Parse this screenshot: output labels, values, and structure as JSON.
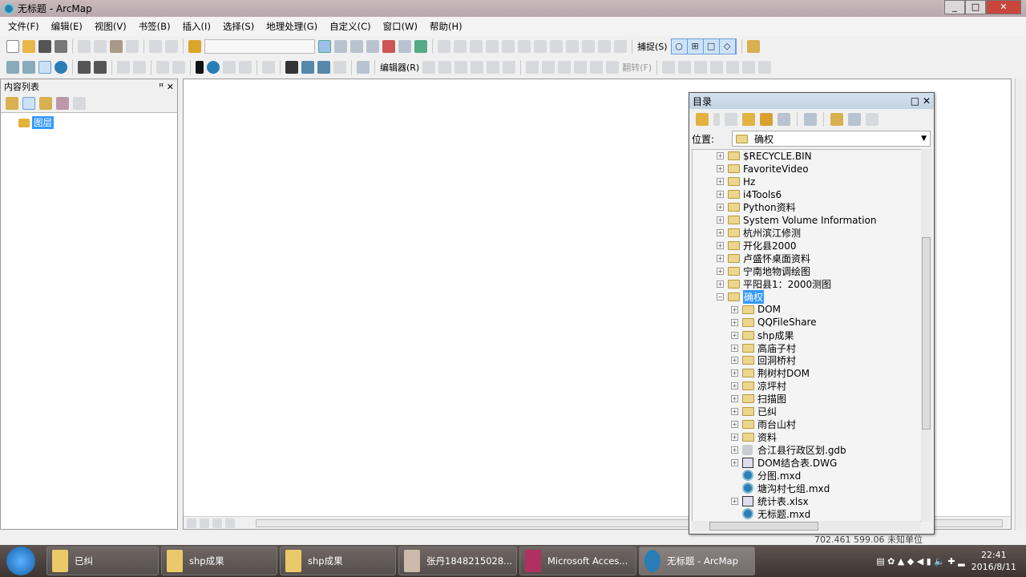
{
  "window": {
    "title": "无标题 - ArcMap"
  },
  "menu": [
    "文件(F)",
    "编辑(E)",
    "视图(V)",
    "书签(B)",
    "插入(I)",
    "选择(S)",
    "地理处理(G)",
    "自定义(C)",
    "窗口(W)",
    "帮助(H)"
  ],
  "toolbar": {
    "snap_label": "捕捉(S)",
    "editor_label": "编辑器(R)",
    "rotate_label": "翻转(F)"
  },
  "toc": {
    "title": "内容列表",
    "layers_label": "图层"
  },
  "catalog": {
    "title": "目录",
    "location_label": "位置:",
    "location_value": "确权",
    "tree": [
      {
        "label": "$RECYCLE.BIN",
        "type": "folder",
        "level": 0,
        "expander": "+"
      },
      {
        "label": "FavoriteVideo",
        "type": "folder",
        "level": 0,
        "expander": "+"
      },
      {
        "label": "Hz",
        "type": "folder",
        "level": 0,
        "expander": "+"
      },
      {
        "label": "i4Tools6",
        "type": "folder",
        "level": 0,
        "expander": "+"
      },
      {
        "label": "Python资料",
        "type": "folder",
        "level": 0,
        "expander": "+"
      },
      {
        "label": "System Volume Information",
        "type": "folder",
        "level": 0,
        "expander": "+"
      },
      {
        "label": "杭州滨江修测",
        "type": "folder",
        "level": 0,
        "expander": "+"
      },
      {
        "label": "开化县2000",
        "type": "folder",
        "level": 0,
        "expander": "+"
      },
      {
        "label": "卢盛怀桌面资料",
        "type": "folder",
        "level": 0,
        "expander": "+"
      },
      {
        "label": "宁南地物调绘图",
        "type": "folder",
        "level": 0,
        "expander": "+"
      },
      {
        "label": "平阳县1：2000测图",
        "type": "folder",
        "level": 0,
        "expander": "+"
      },
      {
        "label": "确权",
        "type": "folder",
        "level": 0,
        "expander": "-",
        "selected": true
      },
      {
        "label": "DOM",
        "type": "folder",
        "level": 1,
        "expander": "+"
      },
      {
        "label": "QQFileShare",
        "type": "folder",
        "level": 1,
        "expander": "+"
      },
      {
        "label": "shp成果",
        "type": "folder",
        "level": 1,
        "expander": "+"
      },
      {
        "label": "高庙子村",
        "type": "folder",
        "level": 1,
        "expander": "+"
      },
      {
        "label": "回洞桥村",
        "type": "folder",
        "level": 1,
        "expander": "+"
      },
      {
        "label": "荆树村DOM",
        "type": "folder",
        "level": 1,
        "expander": "+"
      },
      {
        "label": "凉坪村",
        "type": "folder",
        "level": 1,
        "expander": "+"
      },
      {
        "label": "扫描图",
        "type": "folder",
        "level": 1,
        "expander": "+"
      },
      {
        "label": "已纠",
        "type": "folder",
        "level": 1,
        "expander": "+"
      },
      {
        "label": "雨台山村",
        "type": "folder",
        "level": 1,
        "expander": "+"
      },
      {
        "label": "资料",
        "type": "folder",
        "level": 1,
        "expander": "+"
      },
      {
        "label": "合江县行政区划.gdb",
        "type": "gdb",
        "level": 1,
        "expander": "+"
      },
      {
        "label": "DOM结合表.DWG",
        "type": "sheet",
        "level": 1,
        "expander": "+"
      },
      {
        "label": "分图.mxd",
        "type": "mxd",
        "level": 1,
        "expander": ""
      },
      {
        "label": "塘沟村七组.mxd",
        "type": "mxd",
        "level": 1,
        "expander": ""
      },
      {
        "label": "统计表.xlsx",
        "type": "sheet",
        "level": 1,
        "expander": "+"
      },
      {
        "label": "无标题.mxd",
        "type": "mxd",
        "level": 1,
        "expander": ""
      }
    ]
  },
  "status": {
    "coords": "702.461  599.06 未知单位"
  },
  "taskbar": {
    "items": [
      "已纠",
      "shp成果",
      "shp成果",
      "张丹1848215028...",
      "Microsoft Acces...",
      "无标题 - ArcMap"
    ],
    "time": "22:41",
    "date": "2016/8/11"
  }
}
